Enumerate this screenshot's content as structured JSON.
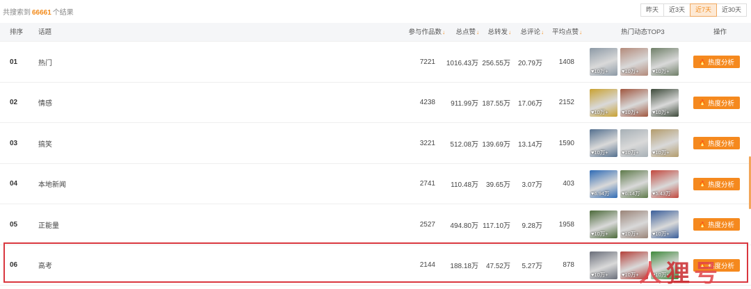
{
  "summary": {
    "prefix": "共搜索到",
    "count": "66661",
    "suffix": "个结果"
  },
  "ranges": [
    {
      "label": "昨天",
      "active": false
    },
    {
      "label": "近3天",
      "active": false
    },
    {
      "label": "近7天",
      "active": true
    },
    {
      "label": "近30天",
      "active": false
    }
  ],
  "columns": {
    "rank": "排序",
    "topic": "话题",
    "works": "参与作品数",
    "likes": "总点赞",
    "shares": "总转发",
    "comments": "总评论",
    "avg": "平均点赞",
    "top3": "热门动态TOP3",
    "action": "操作",
    "sort_icon": "↓"
  },
  "action_label": "热度分析",
  "fire_icon": "🔥",
  "heart_icon": "♥",
  "rows": [
    {
      "rank": "01",
      "topic": "热门",
      "works": "7221",
      "likes": "1016.43万",
      "shares": "256.55万",
      "comments": "20.79万",
      "avg": "1408",
      "thumbs": [
        {
          "badge": "10万+",
          "color": "#8d9aa6"
        },
        {
          "badge": "10万+",
          "color": "#b38a7a"
        },
        {
          "badge": "10万+",
          "color": "#6f7f68"
        }
      ]
    },
    {
      "rank": "02",
      "topic": "情感",
      "works": "4238",
      "likes": "911.99万",
      "shares": "187.55万",
      "comments": "17.06万",
      "avg": "2152",
      "thumbs": [
        {
          "badge": "10万+",
          "color": "#c9a232"
        },
        {
          "badge": "10万+",
          "color": "#a0563f"
        },
        {
          "badge": "10万+",
          "color": "#3d4a3a"
        }
      ]
    },
    {
      "rank": "03",
      "topic": "搞笑",
      "works": "3221",
      "likes": "512.08万",
      "shares": "139.69万",
      "comments": "13.14万",
      "avg": "1590",
      "thumbs": [
        {
          "badge": "10万+",
          "color": "#54708f"
        },
        {
          "badge": "10万+",
          "color": "#a7b0b6"
        },
        {
          "badge": "10万+",
          "color": "#b39c6c"
        }
      ]
    },
    {
      "rank": "04",
      "topic": "本地新闻",
      "works": "2741",
      "likes": "110.48万",
      "shares": "39.65万",
      "comments": "3.07万",
      "avg": "403",
      "thumbs": [
        {
          "badge": "6.94万",
          "color": "#2f6bb5"
        },
        {
          "badge": "6.14万",
          "color": "#5e7a4a"
        },
        {
          "badge": "5.43万",
          "color": "#c2483e"
        }
      ]
    },
    {
      "rank": "05",
      "topic": "正能量",
      "works": "2527",
      "likes": "494.80万",
      "shares": "117.10万",
      "comments": "9.28万",
      "avg": "1958",
      "thumbs": [
        {
          "badge": "10万+",
          "color": "#4c6a3a"
        },
        {
          "badge": "10万+",
          "color": "#9a8478"
        },
        {
          "badge": "10万+",
          "color": "#3a5e9a"
        }
      ]
    },
    {
      "rank": "06",
      "topic": "高考",
      "works": "2144",
      "likes": "188.18万",
      "shares": "47.52万",
      "comments": "5.27万",
      "avg": "878",
      "thumbs": [
        {
          "badge": "10万+",
          "color": "#6a6e7a"
        },
        {
          "badge": "10万+",
          "color": "#b4403a"
        },
        {
          "badge": "10万+",
          "color": "#3f8a3c"
        }
      ]
    }
  ],
  "watermark": [
    "人",
    "狸",
    "号"
  ],
  "colors": {
    "accent": "#f28a1a",
    "button": "#f5891e",
    "highlight": "#d9363e"
  }
}
